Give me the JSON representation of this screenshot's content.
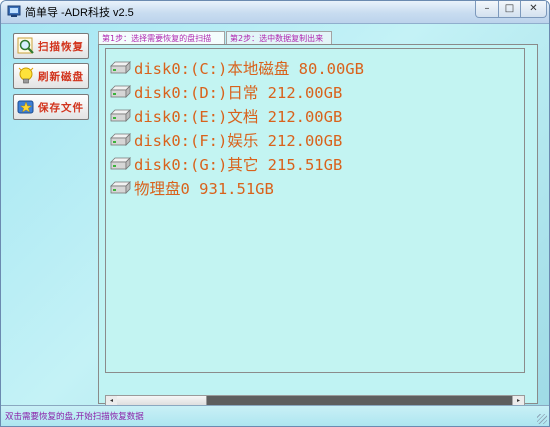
{
  "window": {
    "title": "简单导   -ADR科技 v2.5",
    "controls": {
      "minimize": "–",
      "maximize": "□",
      "close": "✕"
    }
  },
  "sidebar": {
    "buttons": [
      {
        "label": "扫描恢复",
        "icon": "magnifier-icon"
      },
      {
        "label": "刷新磁盘",
        "icon": "lightbulb-icon"
      },
      {
        "label": "保存文件",
        "icon": "save-star-icon"
      }
    ]
  },
  "tabs": [
    {
      "label": "第1步：选择需要恢复的盘扫描",
      "active": true
    },
    {
      "label": "第2步：选中数据复制出来",
      "active": false
    }
  ],
  "tree": {
    "items": [
      {
        "label": "disk0:(C:)本地磁盘 80.00GB"
      },
      {
        "label": "disk0:(D:)日常 212.00GB"
      },
      {
        "label": "disk0:(E:)文档 212.00GB"
      },
      {
        "label": "disk0:(F:)娱乐 212.00GB"
      },
      {
        "label": "disk0:(G:)其它 215.51GB"
      },
      {
        "label": "物理盘0 931.51GB"
      }
    ]
  },
  "scrollbar": {
    "left_arrow": "◂",
    "right_arrow": "▸"
  },
  "status": {
    "text": "双击需要恢复的盘,开始扫描恢复数据"
  },
  "colors": {
    "background": "#aee3f1",
    "item_text": "#d9621c",
    "tab_text": "#b026b0",
    "status_text": "#8b1fa8",
    "button_text": "#d2331c"
  }
}
